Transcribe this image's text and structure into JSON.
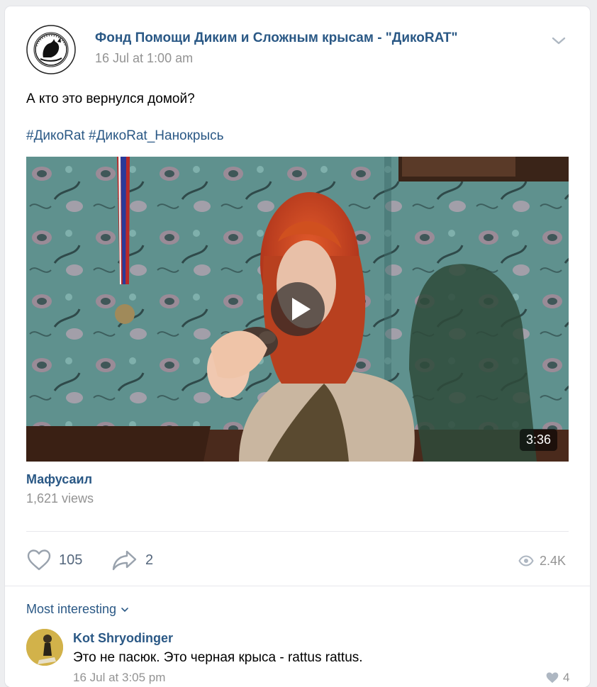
{
  "post": {
    "owner_name": "Фонд Помощи Диким и Сложным крысам - \"ДикоRAT\"",
    "date": "16 Jul at 1:00 am",
    "text": "А кто это вернулся домой?",
    "hashtags": [
      "#ДикоRat",
      "#ДикоRat_Нанокрысь"
    ]
  },
  "video": {
    "duration": "3:36",
    "title": "Мафусаил",
    "views": "1,621 views"
  },
  "actions": {
    "likes": "105",
    "shares": "2",
    "views": "2.4K"
  },
  "comments": {
    "sort_label": "Most interesting",
    "items": [
      {
        "author": "Kot Shryodinger",
        "text": "Это не пасюк. Это черная крыса - rattus rattus.",
        "date": "16 Jul at 3:05 pm",
        "likes": "4"
      }
    ]
  },
  "colors": {
    "link": "#2a5885",
    "muted": "#939393",
    "background": "#edeef0"
  },
  "icons": [
    "community-logo",
    "chevron-down-icon",
    "play-icon",
    "heart-icon",
    "share-icon",
    "eye-icon"
  ]
}
